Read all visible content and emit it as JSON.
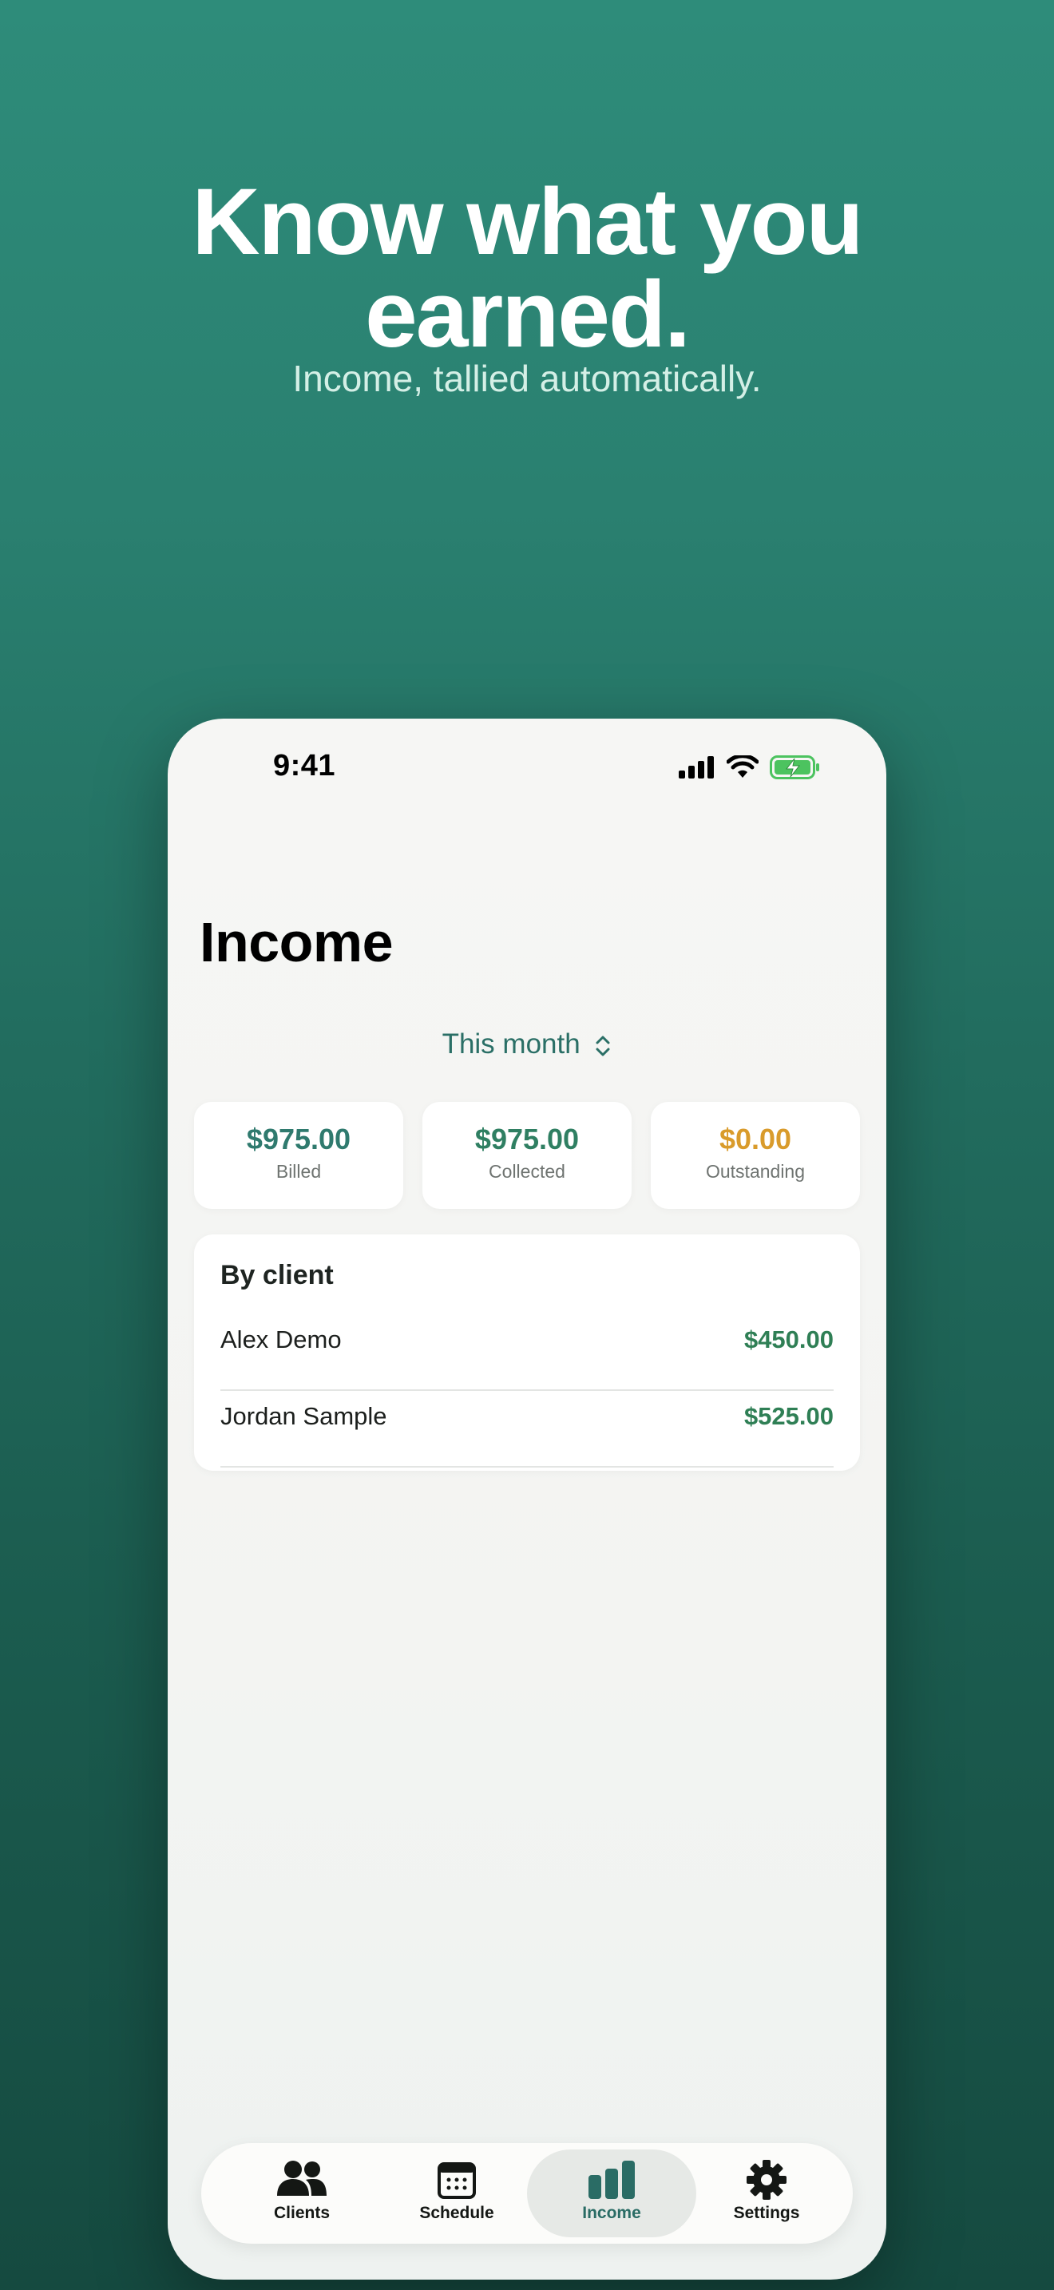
{
  "hero": {
    "headline_line1": "Know what you",
    "headline_line2": "earned.",
    "subhead": "Income, tallied automatically."
  },
  "status_bar": {
    "time": "9:41"
  },
  "screen": {
    "title": "Income",
    "period_label": "This month"
  },
  "stats": [
    {
      "value": "$975.00",
      "label": "Billed"
    },
    {
      "value": "$975.00",
      "label": "Collected"
    },
    {
      "value": "$0.00",
      "label": "Outstanding"
    }
  ],
  "by_client": {
    "title": "By client",
    "rows": [
      {
        "name": "Alex Demo",
        "amount": "$450.00"
      },
      {
        "name": "Jordan Sample",
        "amount": "$525.00"
      }
    ]
  },
  "tab_bar": {
    "active": "Income",
    "tabs": [
      {
        "label": "Clients",
        "icon": "people-icon"
      },
      {
        "label": "Schedule",
        "icon": "calendar-icon"
      },
      {
        "label": "Income",
        "icon": "bar-chart-icon"
      },
      {
        "label": "Settings",
        "icon": "gear-icon"
      }
    ]
  },
  "colors": {
    "accent": "#2a6f66",
    "positive": "#2f7f55",
    "warning": "#d99b2b",
    "background_top": "#2e8c7a",
    "background_bottom": "#154a40"
  }
}
